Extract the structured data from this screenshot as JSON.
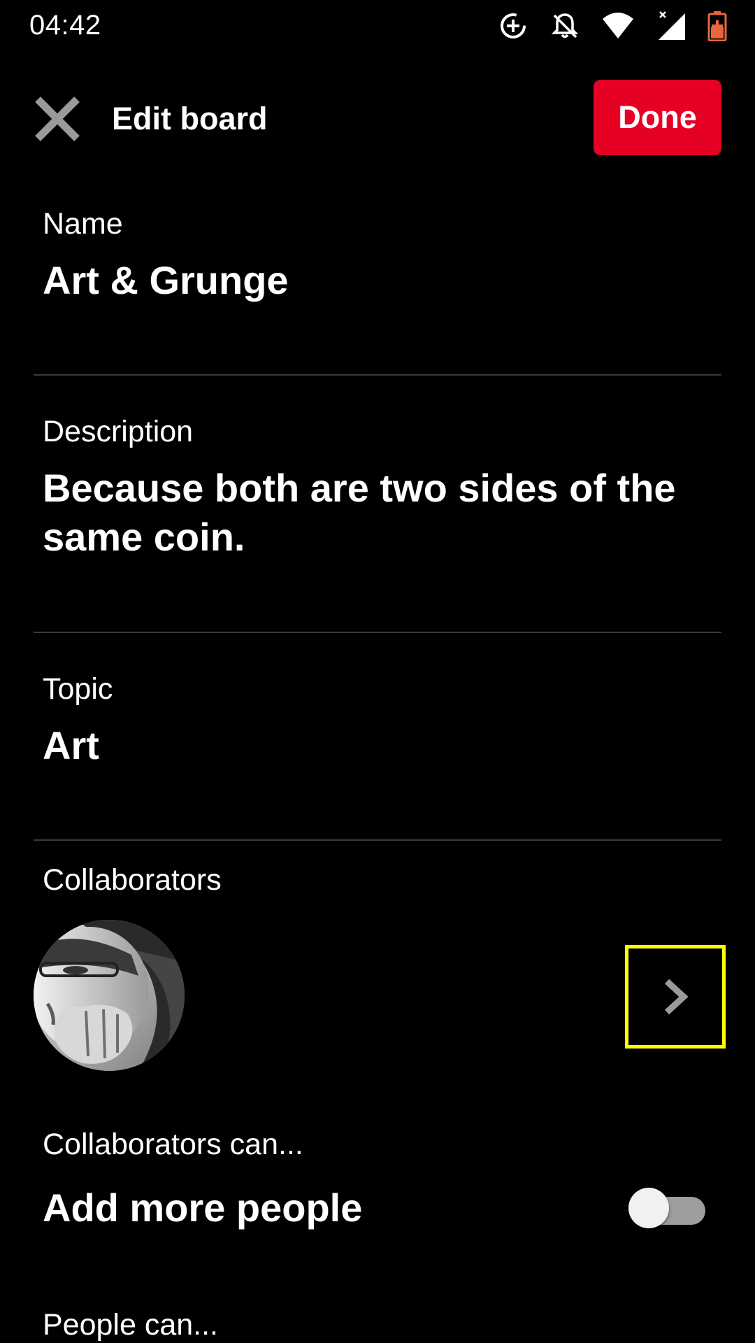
{
  "status_bar": {
    "time": "04:42",
    "icons": [
      "add-circle-icon",
      "notifications-off-icon",
      "wifi-icon",
      "signal-icon",
      "battery-charging-icon"
    ]
  },
  "top_bar": {
    "title": "Edit board",
    "done_label": "Done",
    "close_icon": "close-icon",
    "accent_color": "#e60023"
  },
  "fields": {
    "name": {
      "label": "Name",
      "value": "Art & Grunge"
    },
    "description": {
      "label": "Description",
      "value": "Because both are two sides of the same coin."
    },
    "topic": {
      "label": "Topic",
      "value": "Art"
    }
  },
  "collaborators": {
    "label": "Collaborators",
    "chevron_icon": "chevron-right-icon",
    "highlight_color": "#ffff00"
  },
  "collaborators_can": {
    "label": "Collaborators can...",
    "add_people_label": "Add more people",
    "add_people_enabled": false
  },
  "people_can": {
    "label": "People can..."
  }
}
